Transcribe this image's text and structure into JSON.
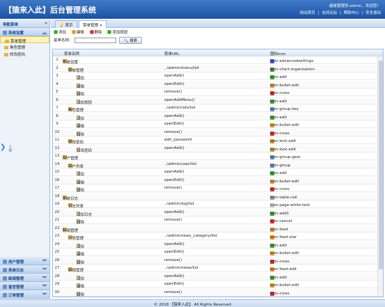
{
  "header": {
    "title": "【猿来入此】后台管理系统",
    "welcome": "超级管理员:admin，欢迎您！",
    "links": [
      "网站首页",
      "|",
      "支持论坛",
      "|",
      "帮助中心",
      "|",
      "安全退出"
    ]
  },
  "sidebar": {
    "title": "导航菜单",
    "group": "系统设置",
    "items": [
      "菜单管理",
      "角色管理",
      "修改密码"
    ],
    "bottom": [
      "用户管理",
      "系统日志",
      "新闻管理",
      "留言管理",
      "订单管理"
    ]
  },
  "tabs": [
    "首页",
    "菜单管理"
  ],
  "toolbar": {
    "add": "添加",
    "edit": "编辑",
    "delete": "删除",
    "add_button": "添加按钮"
  },
  "search": {
    "label": "菜单名称：",
    "button": "搜索"
  },
  "grid": {
    "columns": [
      "菜单名称",
      "菜单URL",
      "图标icon"
    ],
    "rows": [
      {
        "n": "1",
        "lvl": 0,
        "t": "f",
        "name": "系统设置",
        "url": "",
        "icon": "icon-advancedsettings",
        "c": "#3b5bd6"
      },
      {
        "n": "2",
        "lvl": 1,
        "t": "f",
        "name": "菜单管理",
        "url": "../admin/menu/list",
        "icon": "icon-chart-organisation",
        "c": "#4a8d3a"
      },
      {
        "n": "3",
        "lvl": 2,
        "t": "l",
        "name": "添加",
        "url": "openAdd()",
        "icon": "icon-add",
        "c": "#3aaa35"
      },
      {
        "n": "4",
        "lvl": 2,
        "t": "l",
        "name": "编辑",
        "url": "openEdit()",
        "icon": "icon-bullet-edit",
        "c": "#e0a020"
      },
      {
        "n": "5",
        "lvl": 2,
        "t": "l",
        "name": "删除",
        "url": "remove()",
        "icon": "icon-cross",
        "c": "#d33"
      },
      {
        "n": "6",
        "lvl": 2,
        "t": "l",
        "name": "添加按钮",
        "url": "openAddMenu()",
        "icon": "icon-add",
        "c": "#3aaa35"
      },
      {
        "n": "7",
        "lvl": 1,
        "t": "f",
        "name": "角色管理",
        "url": "../admin/role/list",
        "icon": "icon-group-key",
        "c": "#6a8cc8"
      },
      {
        "n": "8",
        "lvl": 2,
        "t": "l",
        "name": "添加",
        "url": "openAdd()",
        "icon": "icon-add",
        "c": "#3aaa35"
      },
      {
        "n": "9",
        "lvl": 2,
        "t": "l",
        "name": "编辑",
        "url": "openEdit()",
        "icon": "icon-bullet-edit",
        "c": "#e0a020"
      },
      {
        "n": "10",
        "lvl": 2,
        "t": "l",
        "name": "删除",
        "url": "remove()",
        "icon": "icon-cross",
        "c": "#d33"
      },
      {
        "n": "11",
        "lvl": 1,
        "t": "f",
        "name": "修改密码",
        "url": "edit_password",
        "icon": "icon-lock-edit",
        "c": "#c89a2a"
      },
      {
        "n": "12",
        "lvl": 2,
        "t": "l",
        "name": "修改密码",
        "url": "openAdd()",
        "icon": "icon-lock-edit",
        "c": "#c89a2a"
      },
      {
        "n": "13",
        "lvl": 0,
        "t": "f",
        "name": "用户管理",
        "url": "",
        "icon": "icon-group-gear",
        "c": "#6a8cc8"
      },
      {
        "n": "14",
        "lvl": 1,
        "t": "f",
        "name": "用户列表",
        "url": "../admin/user/list",
        "icon": "icon-group",
        "c": "#6a8cc8"
      },
      {
        "n": "15",
        "lvl": 2,
        "t": "l",
        "name": "添加",
        "url": "openAdd()",
        "icon": "icon-add",
        "c": "#3aaa35"
      },
      {
        "n": "16",
        "lvl": 2,
        "t": "l",
        "name": "编辑",
        "url": "openEdit()",
        "icon": "icon-bullet-edit",
        "c": "#e0a020"
      },
      {
        "n": "17",
        "lvl": 2,
        "t": "l",
        "name": "删除",
        "url": "remove()",
        "icon": "icon-cross",
        "c": "#d33"
      },
      {
        "n": "18",
        "lvl": 0,
        "t": "f",
        "name": "系统日志",
        "url": "",
        "icon": "icon-table-cell",
        "c": "#8aa"
      },
      {
        "n": "19",
        "lvl": 1,
        "t": "f",
        "name": "日志列表",
        "url": "../admin/log/list",
        "icon": "icon-page-white-text",
        "c": "#ccc"
      },
      {
        "n": "20",
        "lvl": 2,
        "t": "l",
        "name": "添加日志",
        "url": "openAdd()",
        "icon": "icon-add1",
        "c": "#3aaa35"
      },
      {
        "n": "21",
        "lvl": 2,
        "t": "l",
        "name": "删除",
        "url": "remove()",
        "icon": "icon-cancel",
        "c": "#d33"
      },
      {
        "n": "22",
        "lvl": 0,
        "t": "f",
        "name": "新闻管理",
        "url": "",
        "icon": "icon-feed",
        "c": "#f08a1c"
      },
      {
        "n": "23",
        "lvl": 1,
        "t": "f",
        "name": "分类管理",
        "url": "../admin/news_category/list",
        "icon": "icon-feed-star",
        "c": "#f08a1c"
      },
      {
        "n": "24",
        "lvl": 2,
        "t": "l",
        "name": "添加",
        "url": "openAdd()",
        "icon": "icon-add",
        "c": "#3aaa35"
      },
      {
        "n": "25",
        "lvl": 2,
        "t": "l",
        "name": "编辑",
        "url": "openEdit()",
        "icon": "icon-bullet-edit",
        "c": "#e0a020"
      },
      {
        "n": "26",
        "lvl": 2,
        "t": "l",
        "name": "删除",
        "url": "remove()",
        "icon": "icon-cross",
        "c": "#d33"
      },
      {
        "n": "27",
        "lvl": 1,
        "t": "f",
        "name": "新闻管理",
        "url": "../admin/news/list",
        "icon": "icon-feed-edit",
        "c": "#f08a1c"
      },
      {
        "n": "28",
        "lvl": 2,
        "t": "l",
        "name": "添加",
        "url": "openAdd()",
        "icon": "icon-add",
        "c": "#3aaa35"
      },
      {
        "n": "29",
        "lvl": 2,
        "t": "l",
        "name": "编辑",
        "url": "openEdit()",
        "icon": "icon-bullet-edit",
        "c": "#e0a020"
      },
      {
        "n": "30",
        "lvl": 2,
        "t": "l",
        "name": "删除",
        "url": "remove()",
        "icon": "icon-cross",
        "c": "#d33"
      }
    ]
  },
  "footer": "© 2018 【猿来入此】 All Rights Reserved"
}
